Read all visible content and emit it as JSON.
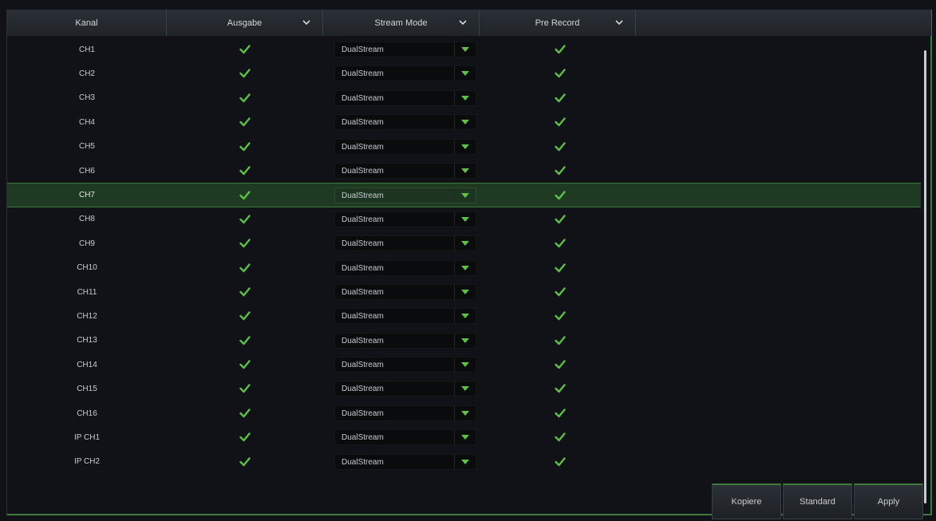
{
  "header": {
    "kanal": "Kanal",
    "ausgabe": "Ausgabe",
    "stream_mode": "Stream Mode",
    "pre_record": "Pre Record"
  },
  "rows": [
    {
      "name": "CH1",
      "ausgabe": true,
      "stream_mode": "DualStream",
      "pre_record": true
    },
    {
      "name": "CH2",
      "ausgabe": true,
      "stream_mode": "DualStream",
      "pre_record": true
    },
    {
      "name": "CH3",
      "ausgabe": true,
      "stream_mode": "DualStream",
      "pre_record": true
    },
    {
      "name": "CH4",
      "ausgabe": true,
      "stream_mode": "DualStream",
      "pre_record": true
    },
    {
      "name": "CH5",
      "ausgabe": true,
      "stream_mode": "DualStream",
      "pre_record": true
    },
    {
      "name": "CH6",
      "ausgabe": true,
      "stream_mode": "DualStream",
      "pre_record": true
    },
    {
      "name": "CH7",
      "ausgabe": true,
      "stream_mode": "DualStream",
      "pre_record": true,
      "selected": true
    },
    {
      "name": "CH8",
      "ausgabe": true,
      "stream_mode": "DualStream",
      "pre_record": true
    },
    {
      "name": "CH9",
      "ausgabe": true,
      "stream_mode": "DualStream",
      "pre_record": true
    },
    {
      "name": "CH10",
      "ausgabe": true,
      "stream_mode": "DualStream",
      "pre_record": true
    },
    {
      "name": "CH11",
      "ausgabe": true,
      "stream_mode": "DualStream",
      "pre_record": true
    },
    {
      "name": "CH12",
      "ausgabe": true,
      "stream_mode": "DualStream",
      "pre_record": true
    },
    {
      "name": "CH13",
      "ausgabe": true,
      "stream_mode": "DualStream",
      "pre_record": true
    },
    {
      "name": "CH14",
      "ausgabe": true,
      "stream_mode": "DualStream",
      "pre_record": true
    },
    {
      "name": "CH15",
      "ausgabe": true,
      "stream_mode": "DualStream",
      "pre_record": true
    },
    {
      "name": "CH16",
      "ausgabe": true,
      "stream_mode": "DualStream",
      "pre_record": true
    },
    {
      "name": "IP CH1",
      "ausgabe": true,
      "stream_mode": "DualStream",
      "pre_record": true
    },
    {
      "name": "IP CH2",
      "ausgabe": true,
      "stream_mode": "DualStream",
      "pre_record": true
    }
  ],
  "buttons": {
    "kopiere": "Kopiere",
    "standard": "Standard",
    "apply": "Apply"
  },
  "colors": {
    "accent": "#3f7a3a",
    "check": "#5fbf4a",
    "selected_row": "#1f3a22"
  }
}
